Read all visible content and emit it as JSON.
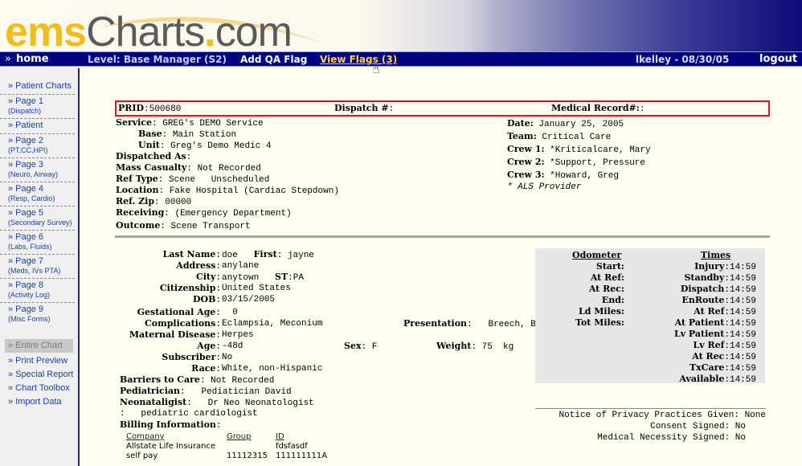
{
  "logo": {
    "ems": "ems",
    "charts": "Charts",
    "dot": ".",
    "com": "com"
  },
  "navbar": {
    "home_icon": "»",
    "home": "home",
    "level": "Level: Base Manager (S2)",
    "add_qa_flag": "Add QA Flag",
    "view_flags": "View Flags (3)",
    "user_date": "lkelley - 08/30/05",
    "logout": "logout"
  },
  "sidebar": {
    "items": [
      {
        "label": "» Patient Charts",
        "sub": ""
      },
      {
        "label": "» Page 1",
        "sub": "(Dispatch)"
      },
      {
        "label": "» Patient",
        "sub": ""
      },
      {
        "label": "» Page 2",
        "sub": "(PT,CC,HPI)"
      },
      {
        "label": "» Page 3",
        "sub": "(Neuro, Airway)"
      },
      {
        "label": "» Page 4",
        "sub": "(Resp, Cardio)"
      },
      {
        "label": "» Page 5",
        "sub": "(Secondary Survey)"
      },
      {
        "label": "» Page 6",
        "sub": "(Labs, Fluids)"
      },
      {
        "label": "» Page 7",
        "sub": "(Meds, IVs PTA)"
      },
      {
        "label": "» Page 8",
        "sub": "(Activity Log)"
      },
      {
        "label": "» Page 9",
        "sub": "(Misc Forms)"
      }
    ],
    "tools": [
      {
        "label": "» Entire Chart",
        "disabled": true
      },
      {
        "label": "» Print Preview",
        "disabled": false
      },
      {
        "label": "» Special Report",
        "disabled": false
      },
      {
        "label": "» Chart Toolbox",
        "disabled": false
      },
      {
        "label": "» Import Data",
        "disabled": false
      }
    ]
  },
  "record": {
    "prid_label": "PRID",
    "prid": "500680",
    "dispatch_label": "Dispatch #",
    "dispatch": "",
    "medical_record_label": "Medical Record#:",
    "medical_record": ""
  },
  "dispatch": {
    "service_label": "Service",
    "service": "GREG's DEMO Service",
    "base_label": "Base",
    "base": "Main Station",
    "unit_label": "Unit",
    "unit": "Greg's Demo Medic 4",
    "dispatched_as_label": "Dispatched As",
    "dispatched_as": "",
    "mass_casualty_label": "Mass Casualty",
    "mass_casualty": "Not Recorded",
    "ref_type_label": "Ref Type",
    "ref_type": "Scene   Unscheduled",
    "location_label": "Location",
    "location": "Fake Hospital (Cardiac Stepdown)",
    "ref_zip_label": "Ref. Zip",
    "ref_zip": "00000",
    "receiving_label": "Receiving",
    "receiving": "(Emergency Department)",
    "outcome_label": "Outcome",
    "outcome": "Scene Transport"
  },
  "crew": {
    "date_label": "Date:",
    "date": "January 25, 2005",
    "team_label": "Team:",
    "team": "Critical Care",
    "crew1_label": "Crew 1:",
    "crew1": "*Kriticalcare, Mary",
    "crew2_label": "Crew 2:",
    "crew2": "*Support, Pressure",
    "crew3_label": "Crew 3:",
    "crew3": "*Howard, Greg",
    "als_note": "* ALS Provider"
  },
  "patient": {
    "last_name_label": "Last Name",
    "last_name": "doe",
    "first_label": "First",
    "first": "jayne",
    "address_label": "Address",
    "address": "anylane",
    "city_label": "City",
    "city": "anytown",
    "st_label": "ST",
    "st": "PA",
    "citizenship_label": "Citizenship",
    "citizenship": "United States",
    "dob_label": "DOB",
    "dob": "03/15/2005",
    "gestational_age_label": "Gestational Age",
    "gestational_age": "0",
    "complications_label": "Complications",
    "complications": "Eclampsia, Meconium",
    "presentation_label": "Presentation",
    "presentation": "Breech, Brow",
    "maternal_disease_label": "Maternal Disease",
    "maternal_disease": "Herpes",
    "age_label": "Age",
    "age": "-48d",
    "sex_label": "Sex",
    "sex": "F",
    "weight_label": "Weight",
    "weight": "75  kg",
    "subscriber_label": "Subscriber",
    "subscriber": "No",
    "race_label": "Race",
    "race": "White, non-Hispanic",
    "barriers_label": "Barriers to Care",
    "barriers": "Not Recorded",
    "pediatrician_label": "Pediatrician",
    "pediatrician": "Pediatician David",
    "neonatologist_label": "Neonataligist",
    "neonatologist": "Dr Neo Neonatologist",
    "cardiologist_line": ":   pediatric cardiologist",
    "billing_label": "Billing Information"
  },
  "billing": {
    "headers": [
      "Company",
      "Group",
      "ID"
    ],
    "rows": [
      [
        "Allstate Life Insurance",
        "",
        "fdsfasdf"
      ],
      [
        "self pay",
        "11112315",
        "111111111A"
      ]
    ]
  },
  "odometer": {
    "title": "Odometer",
    "rows": [
      {
        "label": "Start:",
        "value": ""
      },
      {
        "label": "At Ref:",
        "value": ""
      },
      {
        "label": "At Rec:",
        "value": ""
      },
      {
        "label": "End:",
        "value": ""
      },
      {
        "label": "Ld Miles:",
        "value": ""
      },
      {
        "label": "Tot Miles:",
        "value": ""
      }
    ]
  },
  "times": {
    "title": "Times",
    "rows": [
      {
        "label": "Injury",
        "value": "14:59"
      },
      {
        "label": "Standby",
        "value": "14:59"
      },
      {
        "label": "Dispatch",
        "value": "14:59"
      },
      {
        "label": "EnRoute",
        "value": "14:59"
      },
      {
        "label": "At Ref",
        "value": "14:59"
      },
      {
        "label": "At Patient",
        "value": "14:59"
      },
      {
        "label": "Lv Patient",
        "value": "14:59"
      },
      {
        "label": "Lv Ref",
        "value": "14:59"
      },
      {
        "label": "At Rec",
        "value": "14:59"
      },
      {
        "label": "TxCare",
        "value": "14:59"
      },
      {
        "label": "Available",
        "value": "14:59"
      }
    ]
  },
  "privacy": {
    "notice": "Notice of Privacy Practices Given: None",
    "consent": "Consent Signed: No",
    "necessity": "Medical Necessity Signed: No"
  }
}
